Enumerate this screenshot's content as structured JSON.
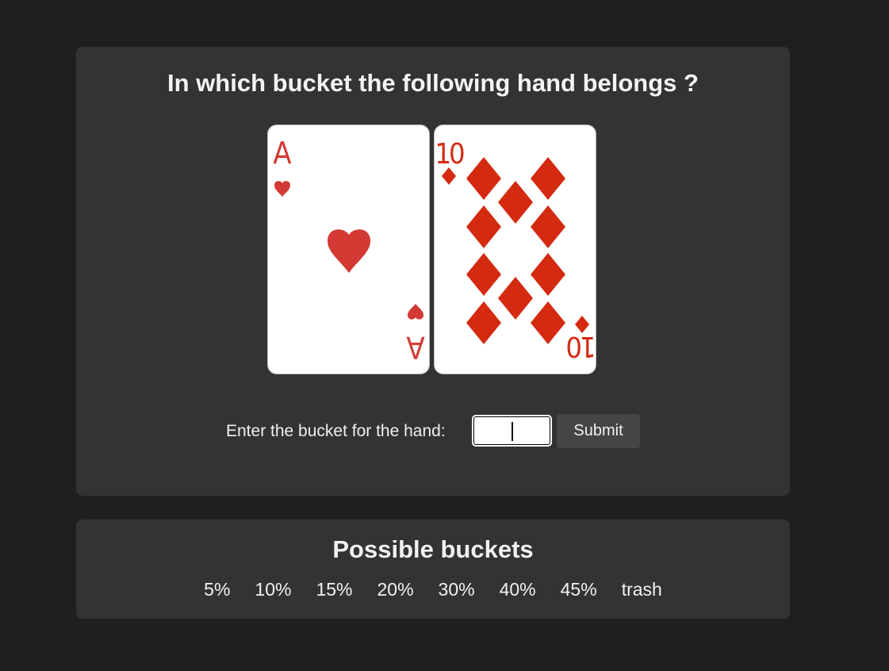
{
  "quiz": {
    "question": "In which bucket the following hand belongs ?",
    "hand": [
      {
        "rank": "A",
        "suit": "hearts",
        "suit_icon": "heart-icon",
        "color": "#d23a33"
      },
      {
        "rank": "10",
        "suit": "diamonds",
        "suit_icon": "diamond-icon",
        "color": "#d42a10"
      }
    ],
    "answer_label": "Enter the bucket for the hand:",
    "answer_value": "",
    "submit_label": "Submit"
  },
  "buckets": {
    "title": "Possible buckets",
    "options": [
      "5%",
      "10%",
      "15%",
      "20%",
      "30%",
      "40%",
      "45%",
      "trash"
    ]
  },
  "colors": {
    "page_bg": "#1f1f1f",
    "panel_bg": "#333333",
    "button_bg": "#454545",
    "card_red_hearts": "#d23a33",
    "card_red_diamonds": "#d42a10"
  }
}
